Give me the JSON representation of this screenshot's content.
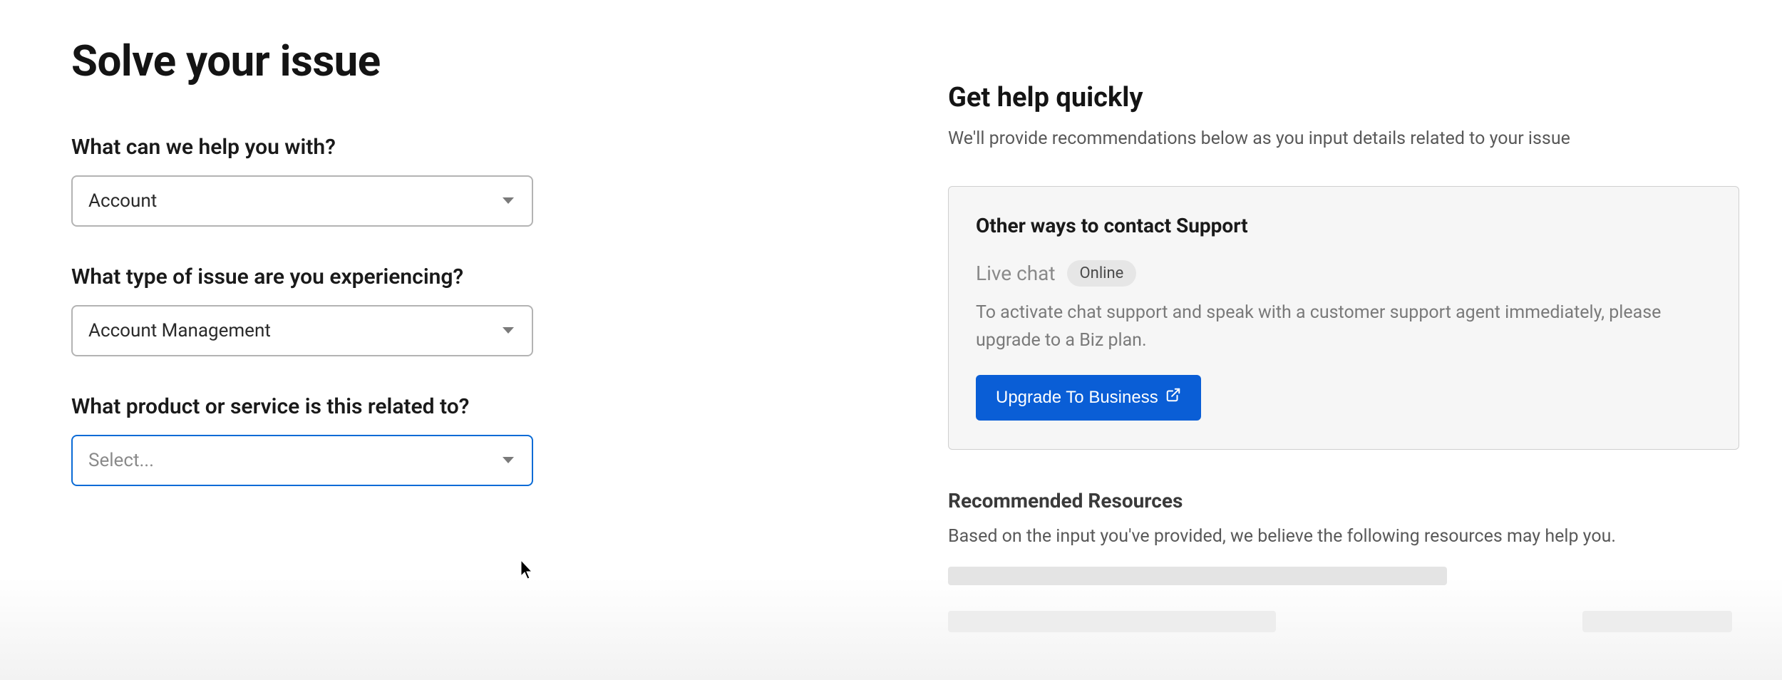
{
  "page": {
    "title": "Solve your issue"
  },
  "form": {
    "q1": {
      "label": "What can we help you with?",
      "value": "Account"
    },
    "q2": {
      "label": "What type of issue are you experiencing?",
      "value": "Account Management"
    },
    "q3": {
      "label": "What product or service is this related to?",
      "placeholder": "Select..."
    }
  },
  "side": {
    "title": "Get help quickly",
    "subtitle": "We'll provide recommendations below as you input details related to your issue",
    "card": {
      "title": "Other ways to contact Support",
      "chat_label": "Live chat",
      "badge": "Online",
      "desc": "To activate chat support and speak with a customer support agent immediately, please upgrade to a Biz plan.",
      "button": "Upgrade To Business"
    },
    "rec": {
      "title": "Recommended Resources",
      "subtitle": "Based on the input you've provided, we believe the following resources may help you."
    }
  }
}
